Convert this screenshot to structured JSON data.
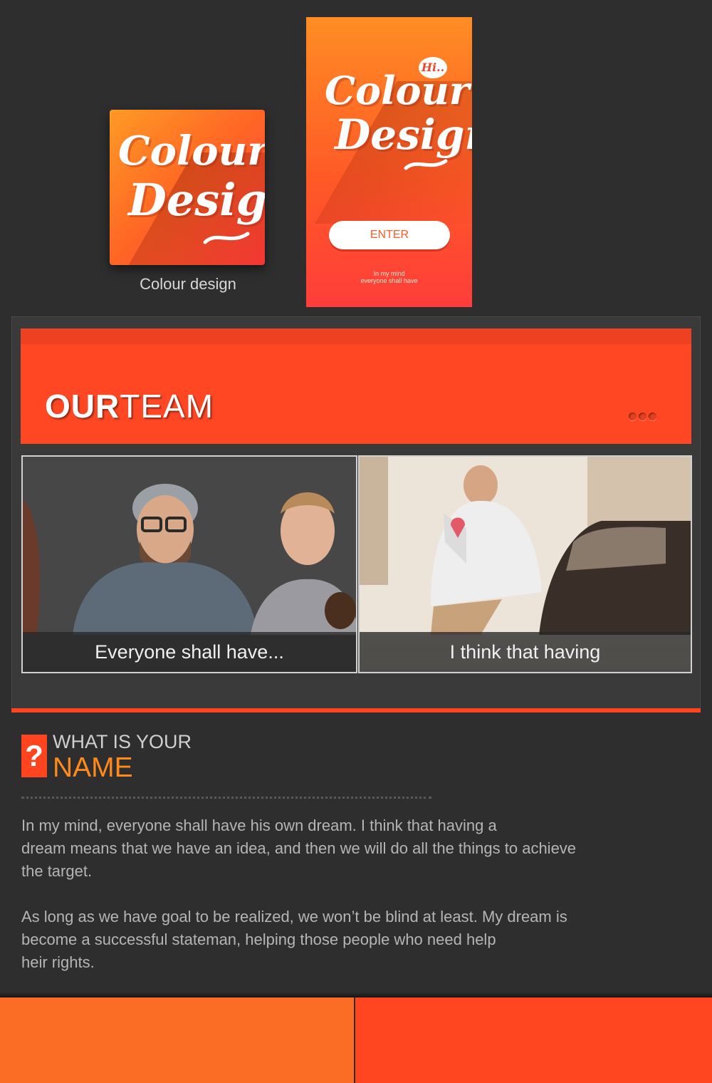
{
  "icon": {
    "logo_line1": "Colour",
    "logo_line2": "Design",
    "caption": "Colour design"
  },
  "splash": {
    "bubble": "Hi..",
    "logo_line1": "Colour",
    "logo_line2": "Design",
    "enter_label": "ENTER",
    "tagline_line1": "In my mind",
    "tagline_line2": "everyone shall have"
  },
  "team": {
    "title_bold": "OUR",
    "title_light": "TEAM",
    "cards": [
      {
        "caption": "Everyone shall have..."
      },
      {
        "caption": "I think that having"
      }
    ]
  },
  "question": {
    "icon": "?",
    "line1": "WHAT IS YOUR",
    "line2": "NAME",
    "p1_l1": "In my mind, everyone shall have his own dream. I think that having a",
    "p1_l2": "dream means that we have an idea, and then we will do all the things to achieve",
    "p1_l3": "the target.",
    "p2_l1": "As long as we have goal to be realized, we won’t be blind at least. My dream is",
    "p2_l2": "become a successful stateman, helping those people who need help",
    "p2_l3": "heir rights."
  },
  "colors": {
    "accent_orange": "#ff4520",
    "highlight_orange": "#ff8a1c",
    "footer_left": "#fb6c25",
    "footer_right": "#ff4621"
  }
}
